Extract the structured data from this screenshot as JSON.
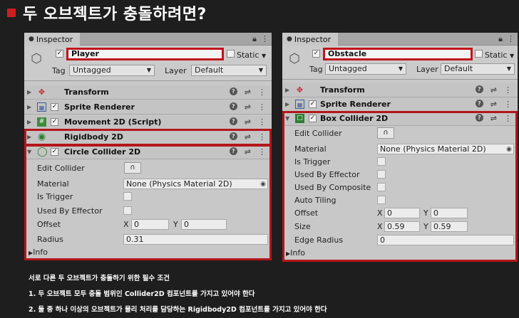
{
  "slide": {
    "title": "두 오브젝트가 충돌하려면?"
  },
  "left": {
    "tab": "Inspector",
    "object_name": "Player",
    "static_label": "Static",
    "tag_label": "Tag",
    "tag_value": "Untagged",
    "layer_label": "Layer",
    "layer_value": "Default",
    "components": [
      "Transform",
      "Sprite Renderer",
      "Movement 2D (Script)",
      "Rigidbody 2D",
      "Circle Collider 2D"
    ],
    "props": {
      "edit_collider": "Edit Collider",
      "material": "Material",
      "material_value": "None (Physics Material 2D)",
      "is_trigger": "Is Trigger",
      "used_by_effector": "Used By Effector",
      "offset": "Offset",
      "offset_x": "0",
      "offset_y": "0",
      "radius": "Radius",
      "radius_value": "0.31",
      "info": "Info"
    }
  },
  "right": {
    "tab": "Inspector",
    "object_name": "Obstacle",
    "static_label": "Static",
    "tag_label": "Tag",
    "tag_value": "Untagged",
    "layer_label": "Layer",
    "layer_value": "Default",
    "components": [
      "Transform",
      "Sprite Renderer",
      "Box Collider 2D"
    ],
    "props": {
      "edit_collider": "Edit Collider",
      "material": "Material",
      "material_value": "None (Physics Material 2D)",
      "is_trigger": "Is Trigger",
      "used_by_effector": "Used By Effector",
      "used_by_composite": "Used By Composite",
      "auto_tiling": "Auto Tiling",
      "offset": "Offset",
      "offset_x": "0",
      "offset_y": "0",
      "size": "Size",
      "size_x": "0.59",
      "size_y": "0.59",
      "edge_radius": "Edge Radius",
      "edge_radius_value": "0",
      "info": "Info"
    }
  },
  "axis": {
    "x": "X",
    "y": "Y"
  },
  "notes": {
    "heading": "서로 다른 두 오브젝트가 충돌하기 위한 필수 조건",
    "line1": "1. 두 오브젝트 모두 충돌 범위인 Collider2D 컴포넌트를 가지고 있어야 한다",
    "line2": "2. 둘 중 하나 이상의 오브젝트가 물리 처리를 담당하는 Rigidbody2D 컴포넌트를 가지고 있어야 한다"
  },
  "colors": {
    "highlight": "#b3161b",
    "bullet": "#cc1f1f",
    "background": "#1e1e1e"
  }
}
